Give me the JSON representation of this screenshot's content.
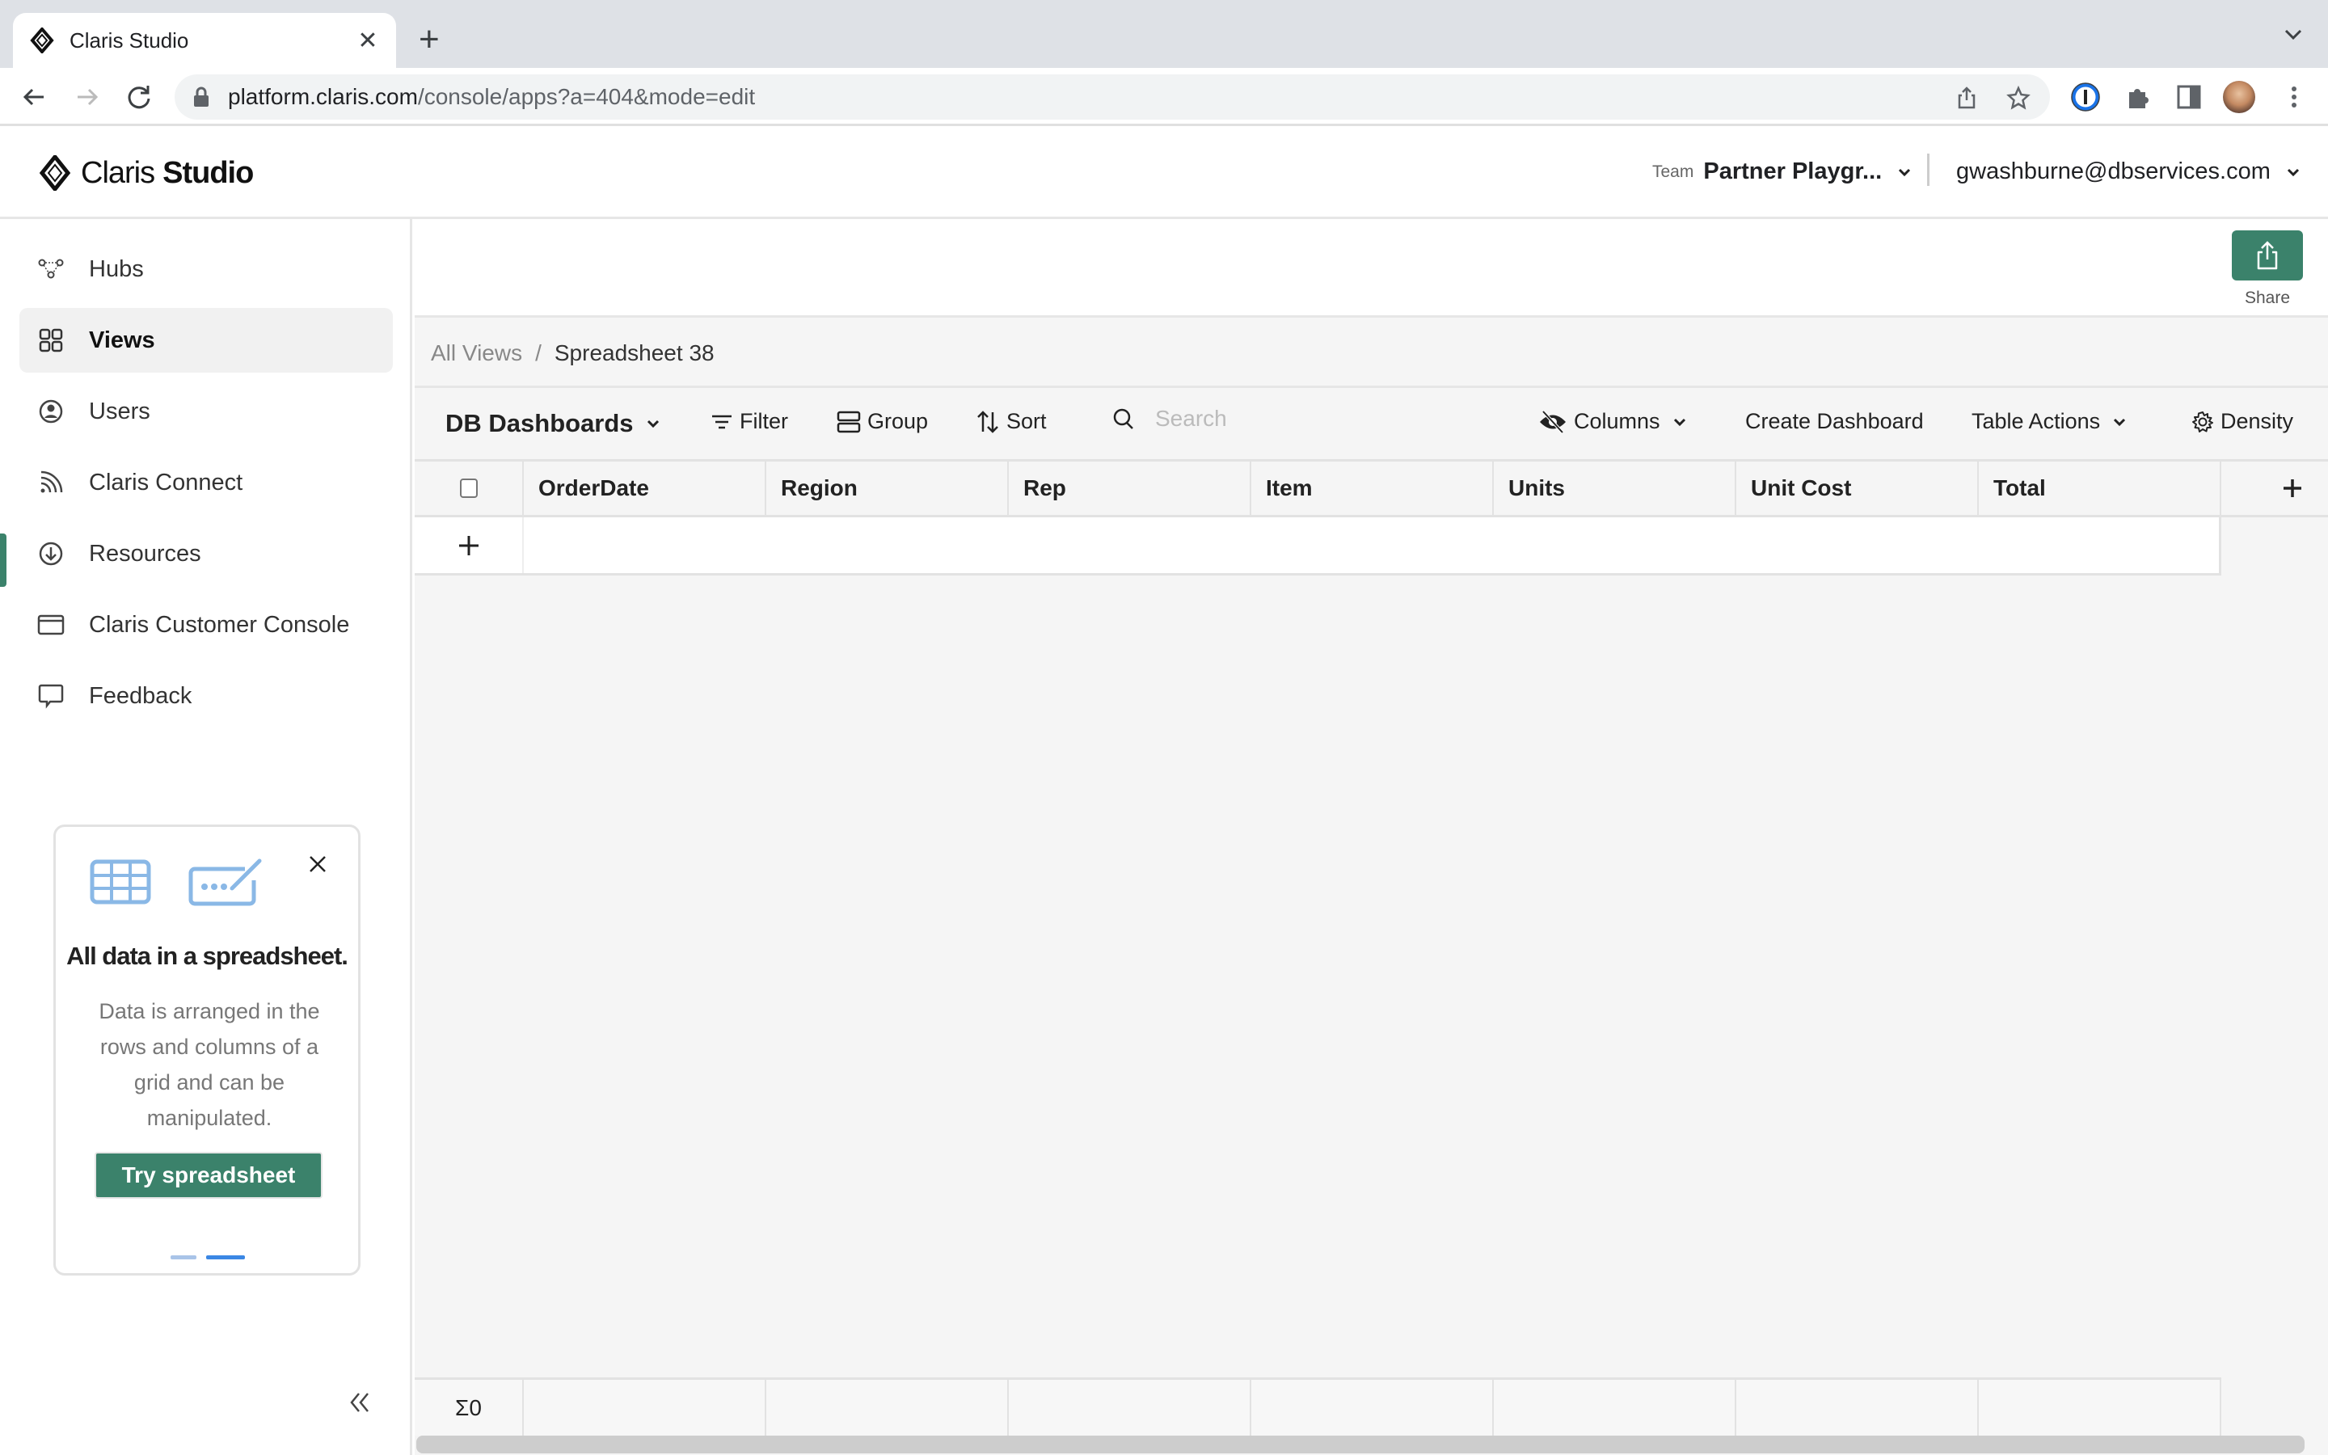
{
  "browser": {
    "tab_title": "Claris Studio",
    "url_host": "platform.claris.com",
    "url_path": "/console/apps?a=404&mode=edit"
  },
  "header": {
    "logo_light": "Claris",
    "logo_bold": "Studio",
    "team_label": "Team",
    "team_name": "Partner Playgr...",
    "user_email": "gwashburne@dbservices.com"
  },
  "sidebar": {
    "items": [
      {
        "label": "Hubs",
        "icon": "hubs-icon"
      },
      {
        "label": "Views",
        "icon": "grid-icon",
        "active": true
      },
      {
        "label": "Users",
        "icon": "user-circle-icon"
      },
      {
        "label": "Claris Connect",
        "icon": "rss-icon"
      },
      {
        "label": "Resources",
        "icon": "download-circle-icon"
      },
      {
        "label": "Claris Customer Console",
        "icon": "browser-window-icon"
      },
      {
        "label": "Feedback",
        "icon": "chat-bubble-icon"
      }
    ],
    "promo": {
      "title": "All data in a spreadsheet.",
      "body": "Data is arranged in the rows and columns of a grid and can be manipulated.",
      "button": "Try spreadsheet",
      "page": 2,
      "pages": 2
    }
  },
  "main": {
    "share_label": "Share",
    "breadcrumb": {
      "root": "All Views",
      "current": "Spreadsheet 38"
    },
    "toolbar": {
      "source": "DB Dashboards",
      "filter": "Filter",
      "group": "Group",
      "sort": "Sort",
      "search_placeholder": "Search",
      "search_value": "",
      "columns": "Columns",
      "create_dashboard": "Create Dashboard",
      "table_actions": "Table Actions",
      "density": "Density"
    },
    "table": {
      "columns": [
        "OrderDate",
        "Region",
        "Rep",
        "Item",
        "Units",
        "Unit Cost",
        "Total"
      ],
      "rows": [],
      "footer_sum": "Σ0"
    }
  },
  "colors": {
    "accent": "#3b826b",
    "promo_icon": "#8ab8e6",
    "progress_active": "#3b87e4"
  }
}
